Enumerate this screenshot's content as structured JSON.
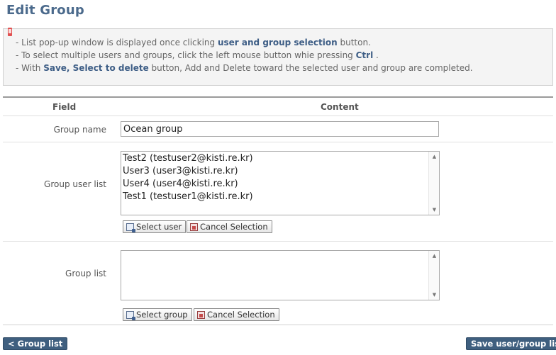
{
  "page": {
    "title": "Edit Group"
  },
  "notice": {
    "line1": {
      "pre": "- List pop-up window is displayed once clicking ",
      "bold": "user and group selection",
      "post": " button."
    },
    "line2": {
      "pre": "- To select multiple users and groups, click the left mouse button whie pressing ",
      "bold": "Ctrl",
      "post": " ."
    },
    "line3": {
      "pre": "- With ",
      "bold": "Save, Select to delete",
      "post": " button, Add and Delete toward the selected user and group are completed."
    }
  },
  "table": {
    "header_field": "Field",
    "header_content": "Content",
    "group_name": {
      "label": "Group name",
      "value": "Ocean group"
    },
    "group_user_list": {
      "label": "Group user list",
      "users": [
        "Test2 (testuser2@kisti.re.kr)",
        "User3 (user3@kisti.re.kr)",
        "User4 (user4@kisti.re.kr)",
        "Test1 (testuser1@kisti.re.kr)"
      ],
      "select_button": "Select user",
      "cancel_button": "Cancel Selection"
    },
    "group_list": {
      "label": "Group list",
      "groups": [],
      "select_button": "Select group",
      "cancel_button": "Cancel Selection"
    }
  },
  "footer": {
    "back_button": "< Group list",
    "save_button": "Save user/group list"
  },
  "icons": {
    "scroll_up": "scroll-up-arrow-icon",
    "scroll_down": "scroll-down-arrow-icon",
    "select": "select-list-icon",
    "cancel": "trash-icon",
    "bookmark": "bookmark-icon"
  },
  "colors": {
    "title": "#4b6a8c",
    "emphasis": "#3e5e86",
    "nav_button": "#3f5f7f",
    "bookmark": "#e05050"
  }
}
